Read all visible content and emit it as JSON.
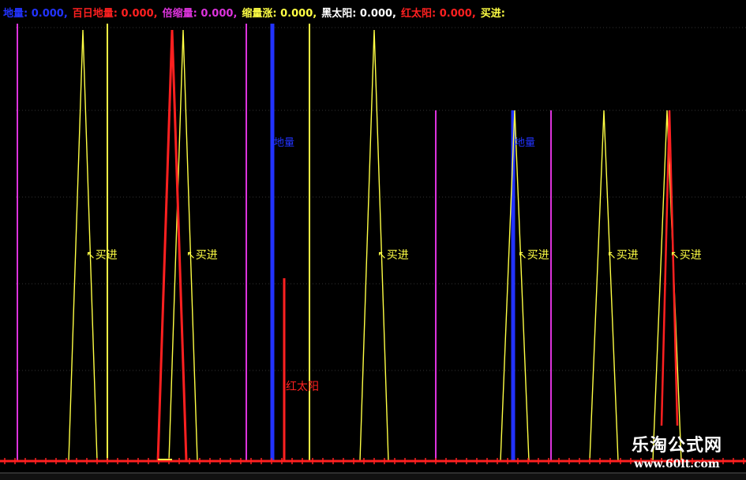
{
  "legend": {
    "items": [
      {
        "label": "地量",
        "value": "0.000",
        "color": "#2233ff"
      },
      {
        "label": "百日地量",
        "value": "0.000",
        "color": "#ff2020"
      },
      {
        "label": "倍缩量",
        "value": "0.000",
        "color": "#dd33dd"
      },
      {
        "label": "缩量涨",
        "value": "0.000",
        "color": "#ffff44"
      },
      {
        "label": "黑太阳",
        "value": "0.000",
        "color": "#ffffff"
      },
      {
        "label": "红太阳",
        "value": "0.000",
        "color": "#ff2020"
      },
      {
        "label": "买进",
        "value": "",
        "color": "#ffff44"
      }
    ]
  },
  "watermark": {
    "title": "乐淘公式网",
    "url": "www.60lt.com"
  },
  "chart_data": {
    "type": "indicator-signals",
    "series": [
      {
        "name": "地量",
        "color": "#2233ff",
        "signal_bars": [
          345,
          650
        ],
        "label": "地量"
      },
      {
        "name": "百日地量",
        "color": "#ff2020",
        "signal_bars": [
          218,
          848
        ]
      },
      {
        "name": "倍缩量",
        "color": "#dd33dd",
        "signal_bars": [
          22,
          312,
          552,
          698
        ]
      },
      {
        "name": "缩量涨",
        "color": "#ffff44",
        "signal_bars": [
          136,
          392
        ]
      },
      {
        "name": "红太阳",
        "color": "#ff2020",
        "signal_bars": [
          360
        ],
        "label": "红太阳"
      },
      {
        "name": "买进",
        "color": "#ffff44",
        "signal_bars": [
          105,
          232,
          474,
          652,
          765,
          845
        ],
        "label": "买进"
      }
    ],
    "baseline_value": 0
  }
}
